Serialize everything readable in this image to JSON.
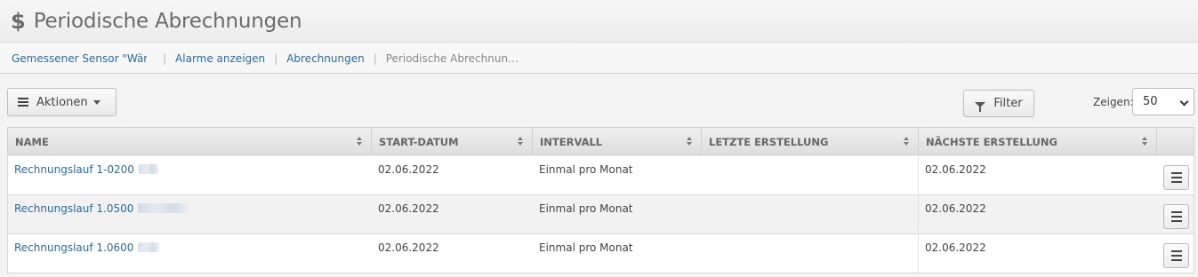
{
  "header": {
    "icon": "dollar-icon",
    "title": "Periodische Abrechnungen"
  },
  "breadcrumb": {
    "items": [
      "Gemessener Sensor \"Wär…",
      "Alarme anzeigen",
      "Abrechnungen"
    ],
    "current": "Periodische Abrechnun…"
  },
  "toolbar": {
    "actions_label": "Aktionen",
    "filter_label": "Filter",
    "show_label": "Zeigen:",
    "show_value": "50"
  },
  "table": {
    "columns": [
      "NAME",
      "START-DATUM",
      "INTERVALL",
      "LETZTE ERSTELLUNG",
      "NÄCHSTE ERSTELLUNG"
    ],
    "rows": [
      {
        "name": "Rechnungslauf 1-0200",
        "start": "02.06.2022",
        "interval": "Einmal pro Monat",
        "last": "",
        "next": "02.06.2022"
      },
      {
        "name": "Rechnungslauf 1.0500",
        "start": "02.06.2022",
        "interval": "Einmal pro Monat",
        "last": "",
        "next": "02.06.2022"
      },
      {
        "name": "Rechnungslauf 1.0600",
        "start": "02.06.2022",
        "interval": "Einmal pro Monat",
        "last": "",
        "next": "02.06.2022"
      }
    ]
  }
}
